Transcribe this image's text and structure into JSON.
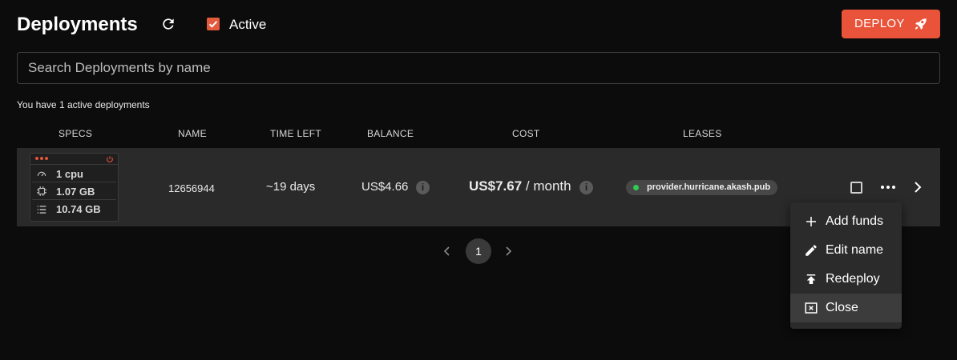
{
  "header": {
    "title": "Deployments",
    "active_label": "Active",
    "active_checked": true,
    "deploy_label": "DEPLOY"
  },
  "search": {
    "placeholder": "Search Deployments by name",
    "value": ""
  },
  "summary": "You have 1 active deployments",
  "columns": [
    "SPECS",
    "NAME",
    "TIME LEFT",
    "BALANCE",
    "COST",
    "LEASES"
  ],
  "deployments": [
    {
      "specs": {
        "cpu": "1 cpu",
        "memory": "1.07 GB",
        "storage": "10.74 GB"
      },
      "name": "12656944",
      "time_left": "~19 days",
      "balance": "US$4.66",
      "cost_amount": "US$7.67",
      "cost_period": " / month",
      "lease": "provider.hurricane.akash.pub"
    }
  ],
  "pagination": {
    "current": "1"
  },
  "menu": {
    "items": [
      {
        "label": "Add funds",
        "icon": "plus-icon"
      },
      {
        "label": "Edit name",
        "icon": "pencil-icon"
      },
      {
        "label": "Redeploy",
        "icon": "upload-icon"
      },
      {
        "label": "Close",
        "icon": "close-box-icon"
      }
    ]
  },
  "colors": {
    "accent": "#e8533a",
    "background": "#0d0c0c",
    "row": "#2a2a2a",
    "lease_status": "#2ecc52"
  }
}
